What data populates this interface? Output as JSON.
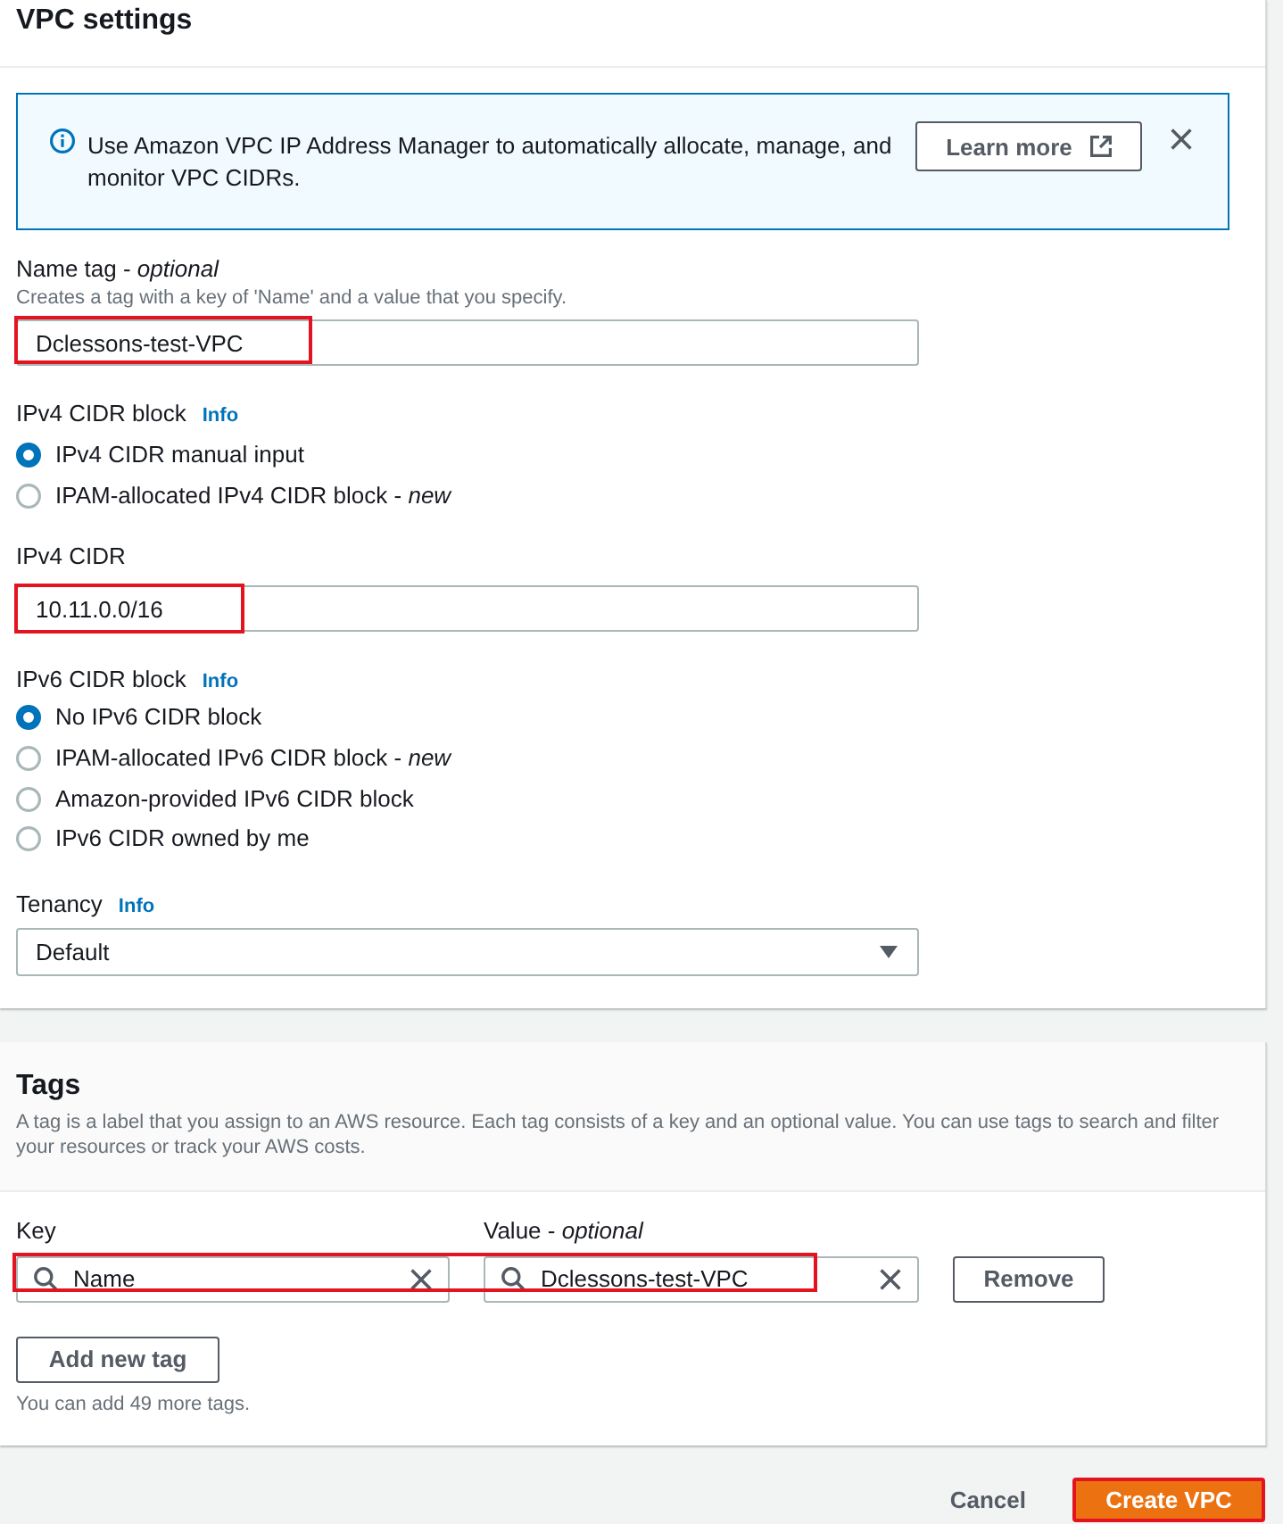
{
  "vpc_settings": {
    "title": "VPC settings",
    "alert": {
      "message": "Use Amazon VPC IP Address Manager to automatically allocate, manage, and monitor VPC CIDRs.",
      "button": "Learn more"
    },
    "name_tag": {
      "label": "Name tag - *optional*",
      "description": "Creates a tag with a key of 'Name' and a value that you specify.",
      "value": "Dclessons-test-VPC",
      "highlighted": true
    },
    "ipv4_cidr_block": {
      "label": "IPv4 CIDR block",
      "info": "Info",
      "options": [
        {
          "label": "IPv4 CIDR manual input",
          "selected": true
        },
        {
          "label": "IPAM-allocated IPv4 CIDR block - *new*",
          "selected": false
        }
      ]
    },
    "ipv4_cidr": {
      "label": "IPv4 CIDR",
      "value": "10.11.0.0/16",
      "highlighted": true
    },
    "ipv6_cidr_block": {
      "label": "IPv6 CIDR block",
      "info": "Info",
      "options": [
        {
          "label": "No IPv6 CIDR block",
          "selected": true
        },
        {
          "label": "IPAM-allocated IPv6 CIDR block - *new*",
          "selected": false
        },
        {
          "label": "Amazon-provided IPv6 CIDR block",
          "selected": false
        },
        {
          "label": "IPv6 CIDR owned by me",
          "selected": false
        }
      ]
    },
    "tenancy": {
      "label": "Tenancy",
      "info": "Info",
      "value": "Default"
    }
  },
  "tags": {
    "title": "Tags",
    "description": "A tag is a label that you assign to an AWS resource. Each tag consists of a key and an optional value. You can use tags to search and filter your resources or track your AWS costs.",
    "key_label": "Key",
    "value_label": "Value - *optional*",
    "rows": [
      {
        "key": "Name",
        "value": "Dclessons-test-VPC",
        "remove_button": "Remove",
        "highlighted": true
      }
    ],
    "add_button": "Add new tag",
    "hint": "You can add 49 more tags."
  },
  "footer": {
    "cancel_button": "Cancel",
    "create_button": {
      "label": "Create VPC",
      "highlighted": true
    }
  }
}
